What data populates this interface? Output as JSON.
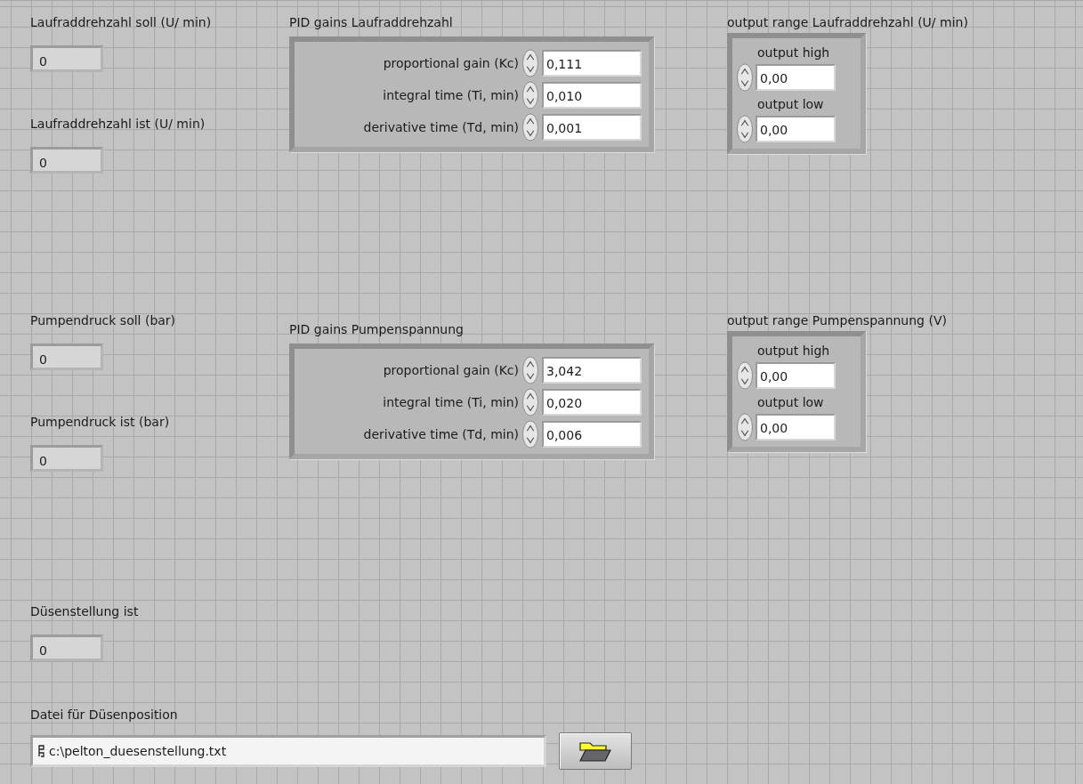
{
  "sections": [
    {
      "indicators": [
        {
          "label": "Laufraddrehzahl soll (U/ min)",
          "value": "0"
        },
        {
          "label": "Laufraddrehzahl ist (U/ min)",
          "value": "0"
        }
      ],
      "pid": {
        "label": "PID gains Laufraddrehzahl",
        "rows": [
          {
            "label": "proportional gain (Kc)",
            "value": "0,111"
          },
          {
            "label": "integral time (Ti, min)",
            "value": "0,010"
          },
          {
            "label": "derivative time (Td, min)",
            "value": "0,001"
          }
        ]
      },
      "output_range": {
        "label": "output range Laufraddrehzahl (U/ min)",
        "rows": [
          {
            "label": "output high",
            "value": "0,00"
          },
          {
            "label": "output low",
            "value": "0,00"
          }
        ]
      }
    },
    {
      "indicators": [
        {
          "label": "Pumpendruck soll (bar)",
          "value": "0"
        },
        {
          "label": "Pumpendruck ist (bar)",
          "value": "0"
        }
      ],
      "pid": {
        "label": "PID gains Pumpenspannung",
        "rows": [
          {
            "label": "proportional gain (Kc)",
            "value": "3,042"
          },
          {
            "label": "integral time (Ti, min)",
            "value": "0,020"
          },
          {
            "label": "derivative time (Td, min)",
            "value": "0,006"
          }
        ]
      },
      "output_range": {
        "label": "output range Pumpenspannung (V)",
        "rows": [
          {
            "label": "output high",
            "value": "0,00"
          },
          {
            "label": "output low",
            "value": "0,00"
          }
        ]
      }
    }
  ],
  "nozzle_indicator": {
    "label": "Düsenstellung ist",
    "value": "0"
  },
  "file_path": {
    "label": "Datei für Düsenposition",
    "value": "c:\\pelton_duesenstellung.txt"
  }
}
